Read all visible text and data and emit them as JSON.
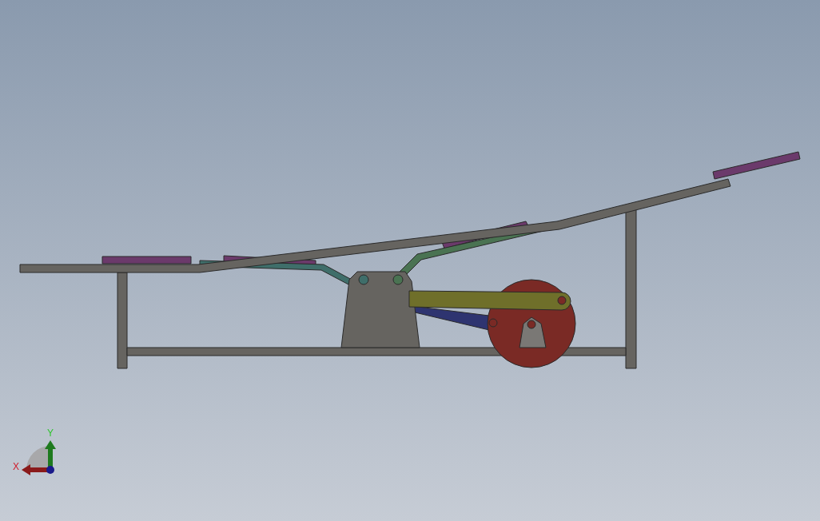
{
  "viewport": {
    "triad": {
      "x_label": "X",
      "y_label": "Y"
    }
  }
}
